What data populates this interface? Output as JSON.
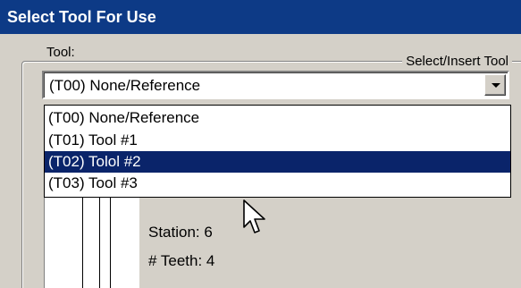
{
  "dialog": {
    "title": "Select Tool For Use"
  },
  "group": {
    "caption": "Select/Insert Tool"
  },
  "tool_field": {
    "label": "Tool:",
    "selected_value": "(T00) None/Reference",
    "options": [
      {
        "label": "(T00) None/Reference",
        "selected": false
      },
      {
        "label": "(T01) Tool #1",
        "selected": false
      },
      {
        "label": "(T02) Tolol #2",
        "selected": true
      },
      {
        "label": "(T03) Tool #3",
        "selected": false
      }
    ]
  },
  "details": {
    "station_text": "Station: 6",
    "teeth_text": "# Teeth: 4"
  },
  "colors": {
    "title_bar": "#0d3a86",
    "selection": "#0a246a",
    "panel": "#d4d0c8"
  },
  "icons": {
    "dropdown": "chevron-down-icon",
    "pointer": "mouse-pointer-icon"
  }
}
